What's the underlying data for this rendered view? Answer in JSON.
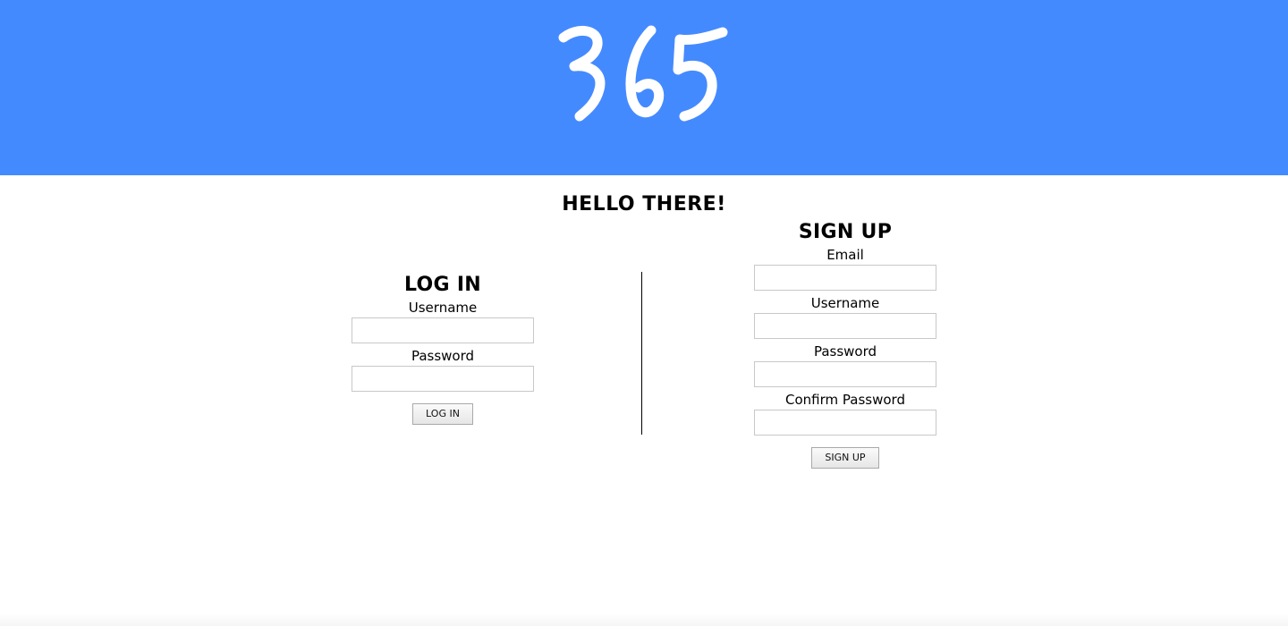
{
  "header": {
    "logo_text": "365",
    "background_color": "#448aff",
    "logo_color": "#ffffff"
  },
  "greeting": "HELLO THERE!",
  "login": {
    "heading": "LOG IN",
    "username_label": "Username",
    "username_value": "",
    "password_label": "Password",
    "password_value": "",
    "button_label": "LOG IN"
  },
  "signup": {
    "heading": "SIGN UP",
    "email_label": "Email",
    "email_value": "",
    "username_label": "Username",
    "username_value": "",
    "password_label": "Password",
    "password_value": "",
    "confirm_label": "Confirm Password",
    "confirm_value": "",
    "button_label": "SIGN UP"
  }
}
